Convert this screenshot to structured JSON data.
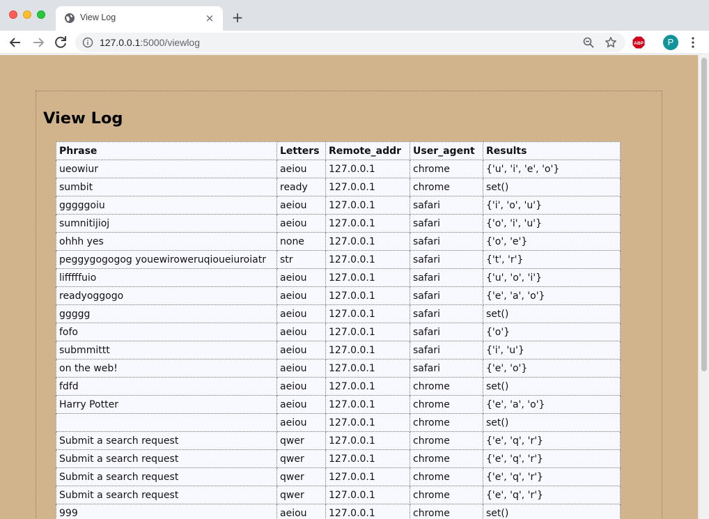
{
  "window": {
    "tab_title": "View Log",
    "tab_close": "×",
    "new_tab": "+"
  },
  "toolbar": {
    "url_host": "127.0.0.1",
    "url_path": ":5000/viewlog",
    "abp_label": "ABP",
    "avatar_letter": "P"
  },
  "page": {
    "title": "View Log",
    "background": "#d2b48c",
    "table_background": "#f8f8ff"
  },
  "table": {
    "headers": [
      "Phrase",
      "Letters",
      "Remote_addr",
      "User_agent",
      "Results"
    ],
    "rows": [
      [
        "ueowiur",
        "aeiou",
        "127.0.0.1",
        "chrome",
        "{'u', 'i', 'e', 'o'}"
      ],
      [
        "sumbit",
        "ready",
        "127.0.0.1",
        "chrome",
        "set()"
      ],
      [
        "gggggoiu",
        "aeiou",
        "127.0.0.1",
        "safari",
        "{'i', 'o', 'u'}"
      ],
      [
        "sumnitijioj",
        "aeiou",
        "127.0.0.1",
        "safari",
        "{'o', 'i', 'u'}"
      ],
      [
        "ohhh yes",
        "none",
        "127.0.0.1",
        "safari",
        "{'o', 'e'}"
      ],
      [
        "peggygogogog youewiroweruqioueiuroiatr",
        "str",
        "127.0.0.1",
        "safari",
        "{'t', 'r'}"
      ],
      [
        "lifffffuio",
        "aeiou",
        "127.0.0.1",
        "safari",
        "{'u', 'o', 'i'}"
      ],
      [
        "readyoggogo",
        "aeiou",
        "127.0.0.1",
        "safari",
        "{'e', 'a', 'o'}"
      ],
      [
        "ggggg",
        "aeiou",
        "127.0.0.1",
        "safari",
        "set()"
      ],
      [
        "fofo",
        "aeiou",
        "127.0.0.1",
        "safari",
        "{'o'}"
      ],
      [
        "submmittt",
        "aeiou",
        "127.0.0.1",
        "safari",
        "{'i', 'u'}"
      ],
      [
        "on the web!",
        "aeiou",
        "127.0.0.1",
        "safari",
        "{'e', 'o'}"
      ],
      [
        "fdfd",
        "aeiou",
        "127.0.0.1",
        "chrome",
        "set()"
      ],
      [
        "Harry Potter",
        "aeiou",
        "127.0.0.1",
        "chrome",
        "{'e', 'a', 'o'}"
      ],
      [
        "",
        "aeiou",
        "127.0.0.1",
        "chrome",
        "set()"
      ],
      [
        "Submit a search request",
        "qwer",
        "127.0.0.1",
        "chrome",
        "{'e', 'q', 'r'}"
      ],
      [
        "Submit a search request",
        "qwer",
        "127.0.0.1",
        "chrome",
        "{'e', 'q', 'r'}"
      ],
      [
        "Submit a search request",
        "qwer",
        "127.0.0.1",
        "chrome",
        "{'e', 'q', 'r'}"
      ],
      [
        "Submit a search request",
        "qwer",
        "127.0.0.1",
        "chrome",
        "{'e', 'q', 'r'}"
      ],
      [
        "999",
        "aeiou",
        "127.0.0.1",
        "chrome",
        "set()"
      ]
    ]
  }
}
